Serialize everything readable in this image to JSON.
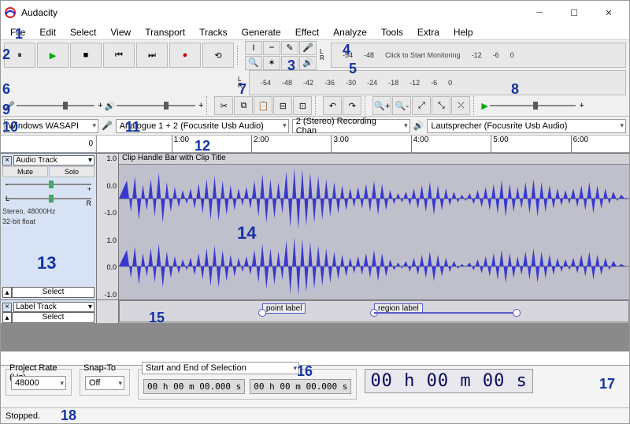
{
  "window": {
    "title": "Audacity"
  },
  "menu": [
    "File",
    "Edit",
    "Select",
    "View",
    "Transport",
    "Tracks",
    "Generate",
    "Effect",
    "Analyze",
    "Tools",
    "Extra",
    "Help"
  ],
  "transport": {
    "pause": "⏸",
    "play": "▶",
    "stop": "■",
    "skip_start": "⏮",
    "skip_end": "⏭",
    "record": "●",
    "loop": "⟲"
  },
  "meters": {
    "rec_monitor_text": "Click to Start Monitoring",
    "ticks": [
      "-54",
      "-48",
      "-42",
      "-36",
      "-30",
      "-24",
      "-18",
      "-12",
      "-6",
      "0"
    ]
  },
  "devices": {
    "host": "Windows WASAPI",
    "rec_device": "Analogue 1 + 2 (Focusrite Usb Audio)",
    "rec_channels": "2 (Stereo) Recording Chan",
    "play_device": "Lautsprecher (Focusrite Usb Audio)"
  },
  "timeline": {
    "start": "0",
    "ticks": [
      "1:00",
      "2:00",
      "3:00",
      "4:00",
      "5:00",
      "6:00"
    ]
  },
  "audio_track": {
    "name": "Audio Track",
    "mute": "Mute",
    "solo": "Solo",
    "format_line1": "Stereo, 48000Hz",
    "format_line2": "32-bit float",
    "scale": [
      "1.0",
      "0.0",
      "-1.0",
      "1.0",
      "0.0",
      "-1.0"
    ],
    "clip_title": "Clip Handle Bar with Clip Title",
    "select": "Select"
  },
  "label_track": {
    "name": "Label Track",
    "select": "Select",
    "point_label": "point label",
    "region_label": "region label"
  },
  "selection": {
    "project_rate_label": "Project Rate (Hz)",
    "project_rate": "48000",
    "snap_label": "Snap-To",
    "snap": "Off",
    "range_label": "Start and End of Selection",
    "t1": "00 h 00 m 00.000 s",
    "t2": "00 h 00 m 00.000 s"
  },
  "big_time": "00 h 00 m 00 s",
  "status": "Stopped.",
  "callouts": {
    "1": "1",
    "2": "2",
    "3": "3",
    "4": "4",
    "5": "5",
    "6": "6",
    "7": "7",
    "8": "8",
    "9": "9",
    "10": "10",
    "11": "11",
    "12": "12",
    "13": "13",
    "14": "14",
    "15": "15",
    "16": "16",
    "17": "17",
    "18": "18"
  }
}
